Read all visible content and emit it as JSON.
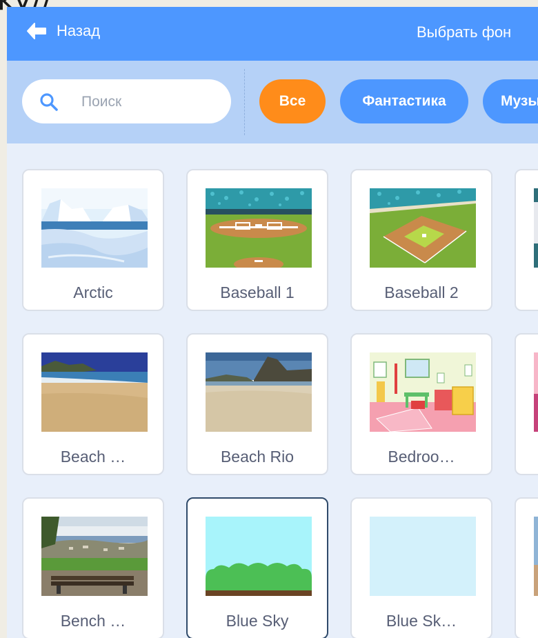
{
  "page_fragment": "ky//",
  "header": {
    "back_label": "Назад",
    "title": "Выбрать фон"
  },
  "search": {
    "placeholder": "Поиск",
    "value": ""
  },
  "tags": [
    {
      "label": "Все",
      "active": true
    },
    {
      "label": "Фантастика",
      "active": false
    },
    {
      "label": "Музы",
      "active": false
    }
  ],
  "colors": {
    "header": "#4d97ff",
    "active_tag": "#ff8c1a",
    "tag": "#4d97ff",
    "filter_bar": "#b5d1f7"
  },
  "backdrops": [
    {
      "label": "Arctic"
    },
    {
      "label": "Baseball 1"
    },
    {
      "label": "Baseball 2"
    },
    {
      "label": ""
    },
    {
      "label": "Beach …"
    },
    {
      "label": "Beach Rio"
    },
    {
      "label": "Bedroo…"
    },
    {
      "label": ""
    },
    {
      "label": "Bench …"
    },
    {
      "label": "Blue Sky",
      "selected": true
    },
    {
      "label": "Blue Sk…"
    },
    {
      "label": ""
    }
  ]
}
